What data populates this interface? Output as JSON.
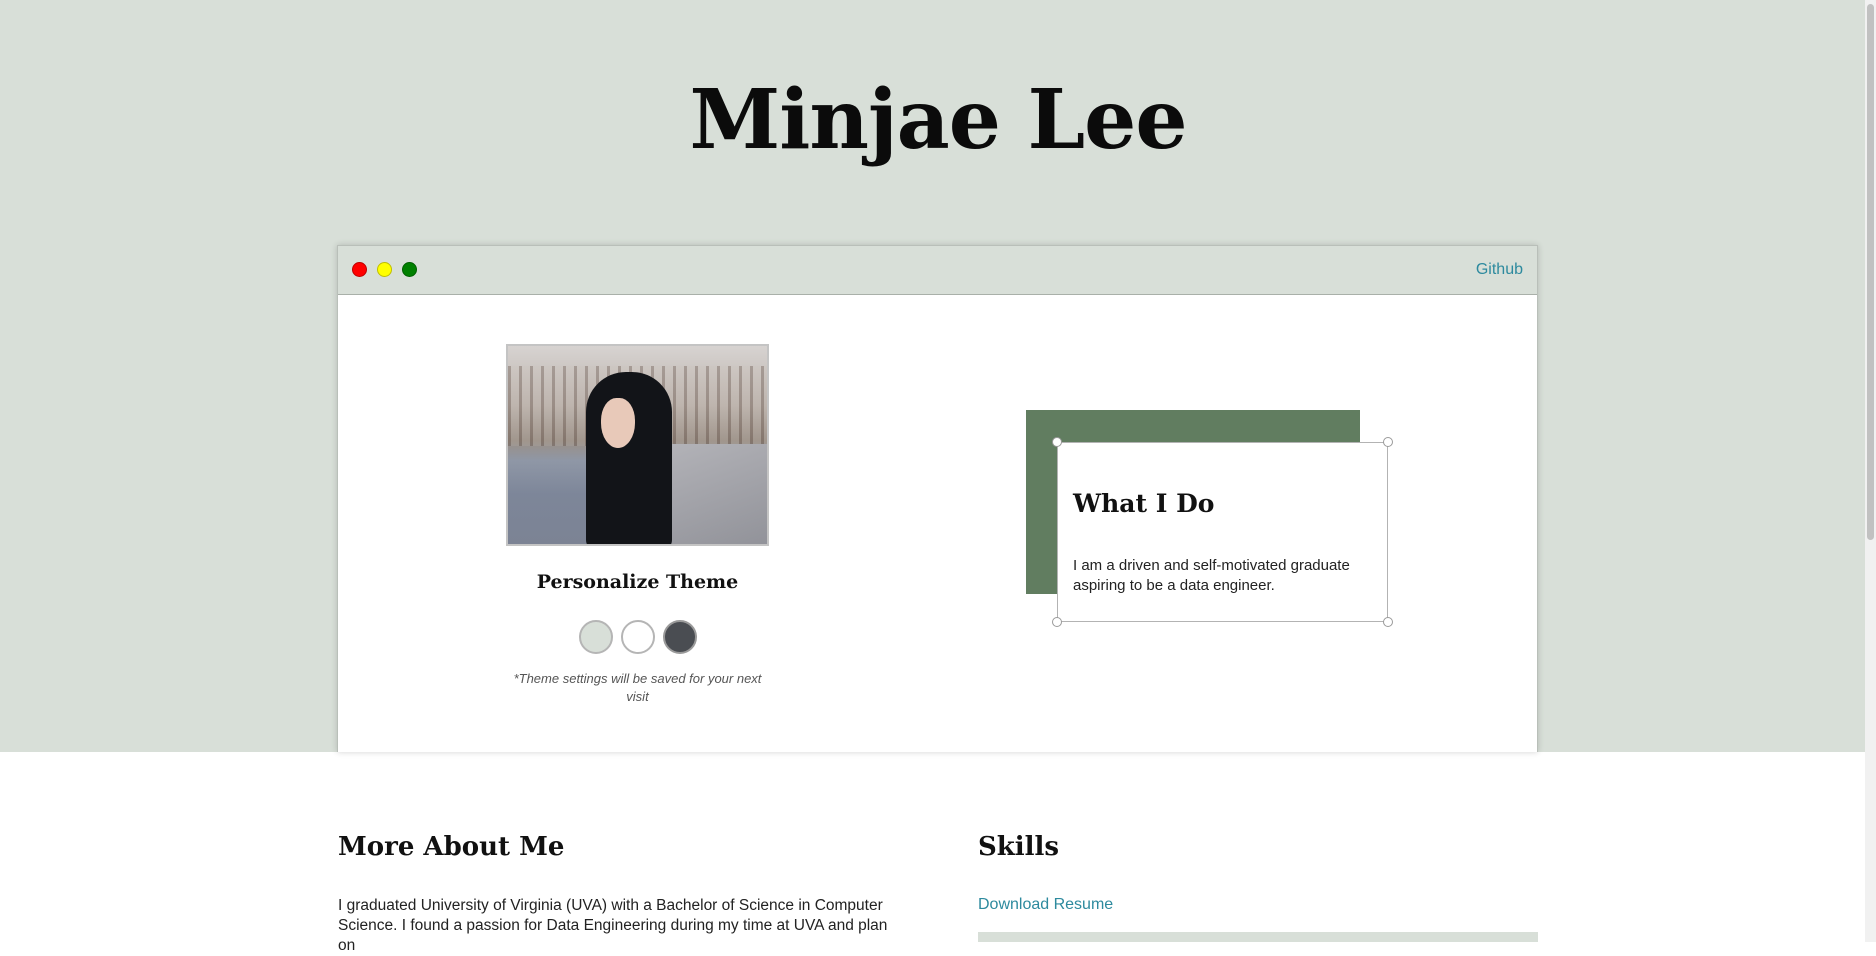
{
  "site": {
    "title": "Minjae Lee"
  },
  "window": {
    "controls": [
      "close",
      "minimize",
      "maximize"
    ],
    "github_label": "Github"
  },
  "profile": {
    "theme_heading": "Personalize Theme",
    "theme_options": [
      {
        "name": "sage",
        "color": "#d8dfd8"
      },
      {
        "name": "white",
        "color": "#ffffff"
      },
      {
        "name": "dark",
        "color": "#4a4d52"
      }
    ],
    "theme_note": "*Theme settings will be saved for your next visit"
  },
  "what_i_do": {
    "title": "What I Do",
    "text": "I am a driven and self-motivated graduate aspiring to be a data engineer."
  },
  "about": {
    "title": "More About Me",
    "text": "I graduated University of Virginia (UVA) with a Bachelor of Science in Computer Science. I found a passion for Data Engineering during my time at UVA and plan on"
  },
  "skills": {
    "title": "Skills",
    "resume_label": "Download Resume"
  },
  "colors": {
    "background": "#d8dfd8",
    "accent_green": "#617d60",
    "link": "#2d8a9e"
  }
}
